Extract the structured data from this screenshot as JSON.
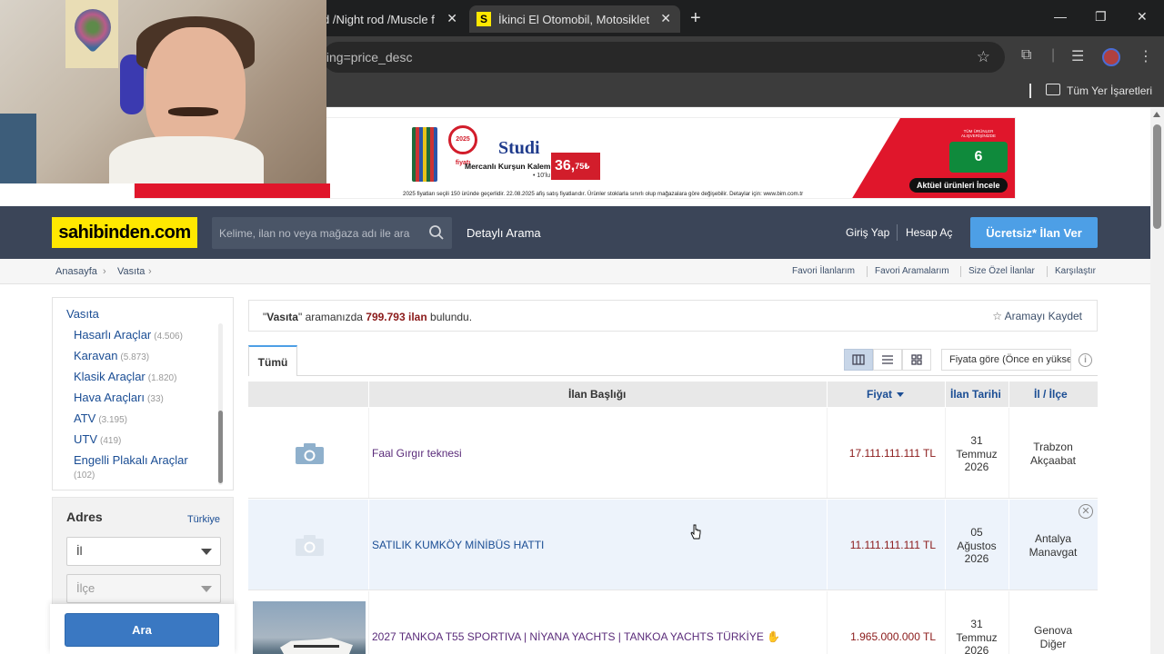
{
  "browser": {
    "tabs": [
      {
        "title": "d /Night rod /Muscle f",
        "active": false
      },
      {
        "title": "İkinci El Otomobil, Motosiklet M",
        "active": true,
        "favicon": "S"
      }
    ],
    "url_visible": "ting=price_desc",
    "bookmarks_label": "Tüm Yer İşaretleri"
  },
  "banner": {
    "seal": "2025 fiyatı",
    "brand": "Studi",
    "product": "Mercanlı Kurşun Kalem",
    "count": "• 10'lu",
    "price_main": "36,",
    "price_cents": "75₺",
    "fine_print": "2025 fiyatları seçili 150 üründe geçerlidir. 22.08.2025 afiş satış fiyatlarıdır. Ürünler stoklarla sınırlı olup mağazalara göre değişebilir. Detaylar için: www.bim.com.tr",
    "installment_top": "TÜM ÜRÜNLER ALIŞVERİŞİNİZDE",
    "installment": "6 TAKSİT",
    "cta": "Aktüel ürünleri İncele"
  },
  "header": {
    "logo": "sahibinden.com",
    "search_placeholder": "Kelime, ilan no veya mağaza adı ile ara",
    "advanced_search": "Detaylı Arama",
    "login": "Giriş Yap",
    "register": "Hesap Aç",
    "post_ad": "Ücretsiz* İlan Ver"
  },
  "breadcrumb": [
    "Anasayfa",
    "Vasıta"
  ],
  "top_links": [
    "Favori İlanlarım",
    "Favori Aramalarım",
    "Size Özel İlanlar",
    "Karşılaştır"
  ],
  "categories": {
    "title": "Vasıta",
    "items": [
      {
        "label": "Hasarlı Araçlar",
        "count": "(4.506)"
      },
      {
        "label": "Karavan",
        "count": "(5.873)"
      },
      {
        "label": "Klasik Araçlar",
        "count": "(1.820)"
      },
      {
        "label": "Hava Araçları",
        "count": "(33)"
      },
      {
        "label": "ATV",
        "count": "(3.195)"
      },
      {
        "label": "UTV",
        "count": "(419)"
      },
      {
        "label": "Engelli Plakalı Araçlar",
        "count": "(102)"
      }
    ]
  },
  "address": {
    "title": "Adres",
    "country": "Türkiye",
    "province_placeholder": "İl",
    "district_placeholder": "İlçe",
    "search_button": "Ara"
  },
  "results": {
    "quote_open": "\"",
    "query": "Vasıta",
    "quote_close": "\" aramanızda",
    "count": "799.793 ilan",
    "suffix": "bulundu.",
    "save_search": "Aramayı Kaydet",
    "tab_all": "Tümü",
    "sort_label": "Fiyata göre (Önce en yüksek)",
    "columns": {
      "title": "İlan Başlığı",
      "price": "Fiyat",
      "date": "İlan Tarihi",
      "location": "İl / İlçe"
    }
  },
  "listings": [
    {
      "title": "Faal Gırgır teknesi",
      "price": "17.111.111.111 TL",
      "date": [
        "31",
        "Temmuz",
        "2026"
      ],
      "location": [
        "Trabzon",
        "Akçaabat"
      ],
      "image": "camera-placeholder"
    },
    {
      "title": "SATILIK KUMKÖY MİNİBÜS HATTI",
      "price": "11.111.111.111 TL",
      "date": [
        "05",
        "Ağustos",
        "2026"
      ],
      "location": [
        "Antalya",
        "Manavgat"
      ],
      "image": "camera-placeholder-faded"
    },
    {
      "title": "2027 TANKOA T55 SPORTIVA | NİYANA YACHTS | TANKOA YACHTS TÜRKİYE",
      "price": "1.965.000.000 TL",
      "date": [
        "31",
        "Temmuz",
        "2026"
      ],
      "location": [
        "Genova",
        "Diğer"
      ],
      "image": "yacht-photo"
    }
  ],
  "colors": {
    "brand_yellow": "#ffe800",
    "header_bg": "#3b4558",
    "post_ad_blue": "#4d9fe6",
    "price_red": "#8b1a1a",
    "link_blue": "#1a4d94"
  }
}
